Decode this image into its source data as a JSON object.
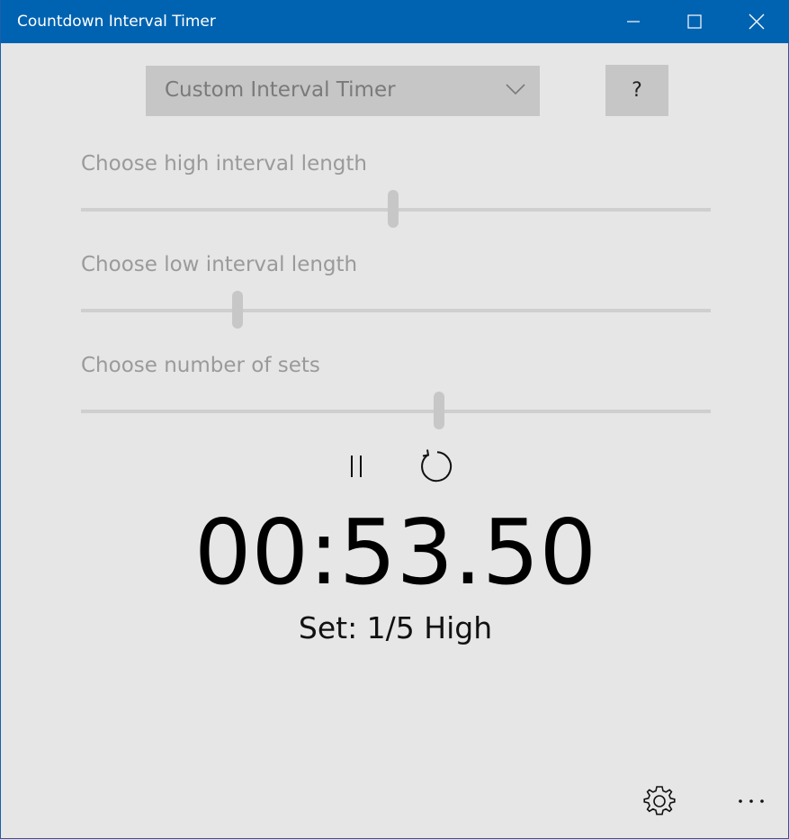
{
  "window": {
    "title": "Countdown Interval Timer"
  },
  "mode_select": {
    "selected": "Custom Interval Timer"
  },
  "help_button": {
    "label": "?"
  },
  "sliders": [
    {
      "label": "Choose high interval length",
      "value_fraction": 0.495
    },
    {
      "label": "Choose low interval length",
      "value_fraction": 0.248
    },
    {
      "label": "Choose number of sets",
      "value_fraction": 0.568
    }
  ],
  "timer": {
    "display": "00:53.50",
    "status": "Set: 1/5 High"
  },
  "icons": {
    "minimize": "minimize-icon",
    "maximize": "maximize-icon",
    "close": "close-icon",
    "dropdown": "chevron-down-icon",
    "pause": "pause-icon",
    "reset": "reset-icon",
    "settings": "gear-icon",
    "more": "more-icon"
  },
  "colors": {
    "titlebar": "#0063b1",
    "background": "#e6e6e6",
    "control_fill": "#c6c6c6",
    "label_text": "#9a9a9a"
  }
}
